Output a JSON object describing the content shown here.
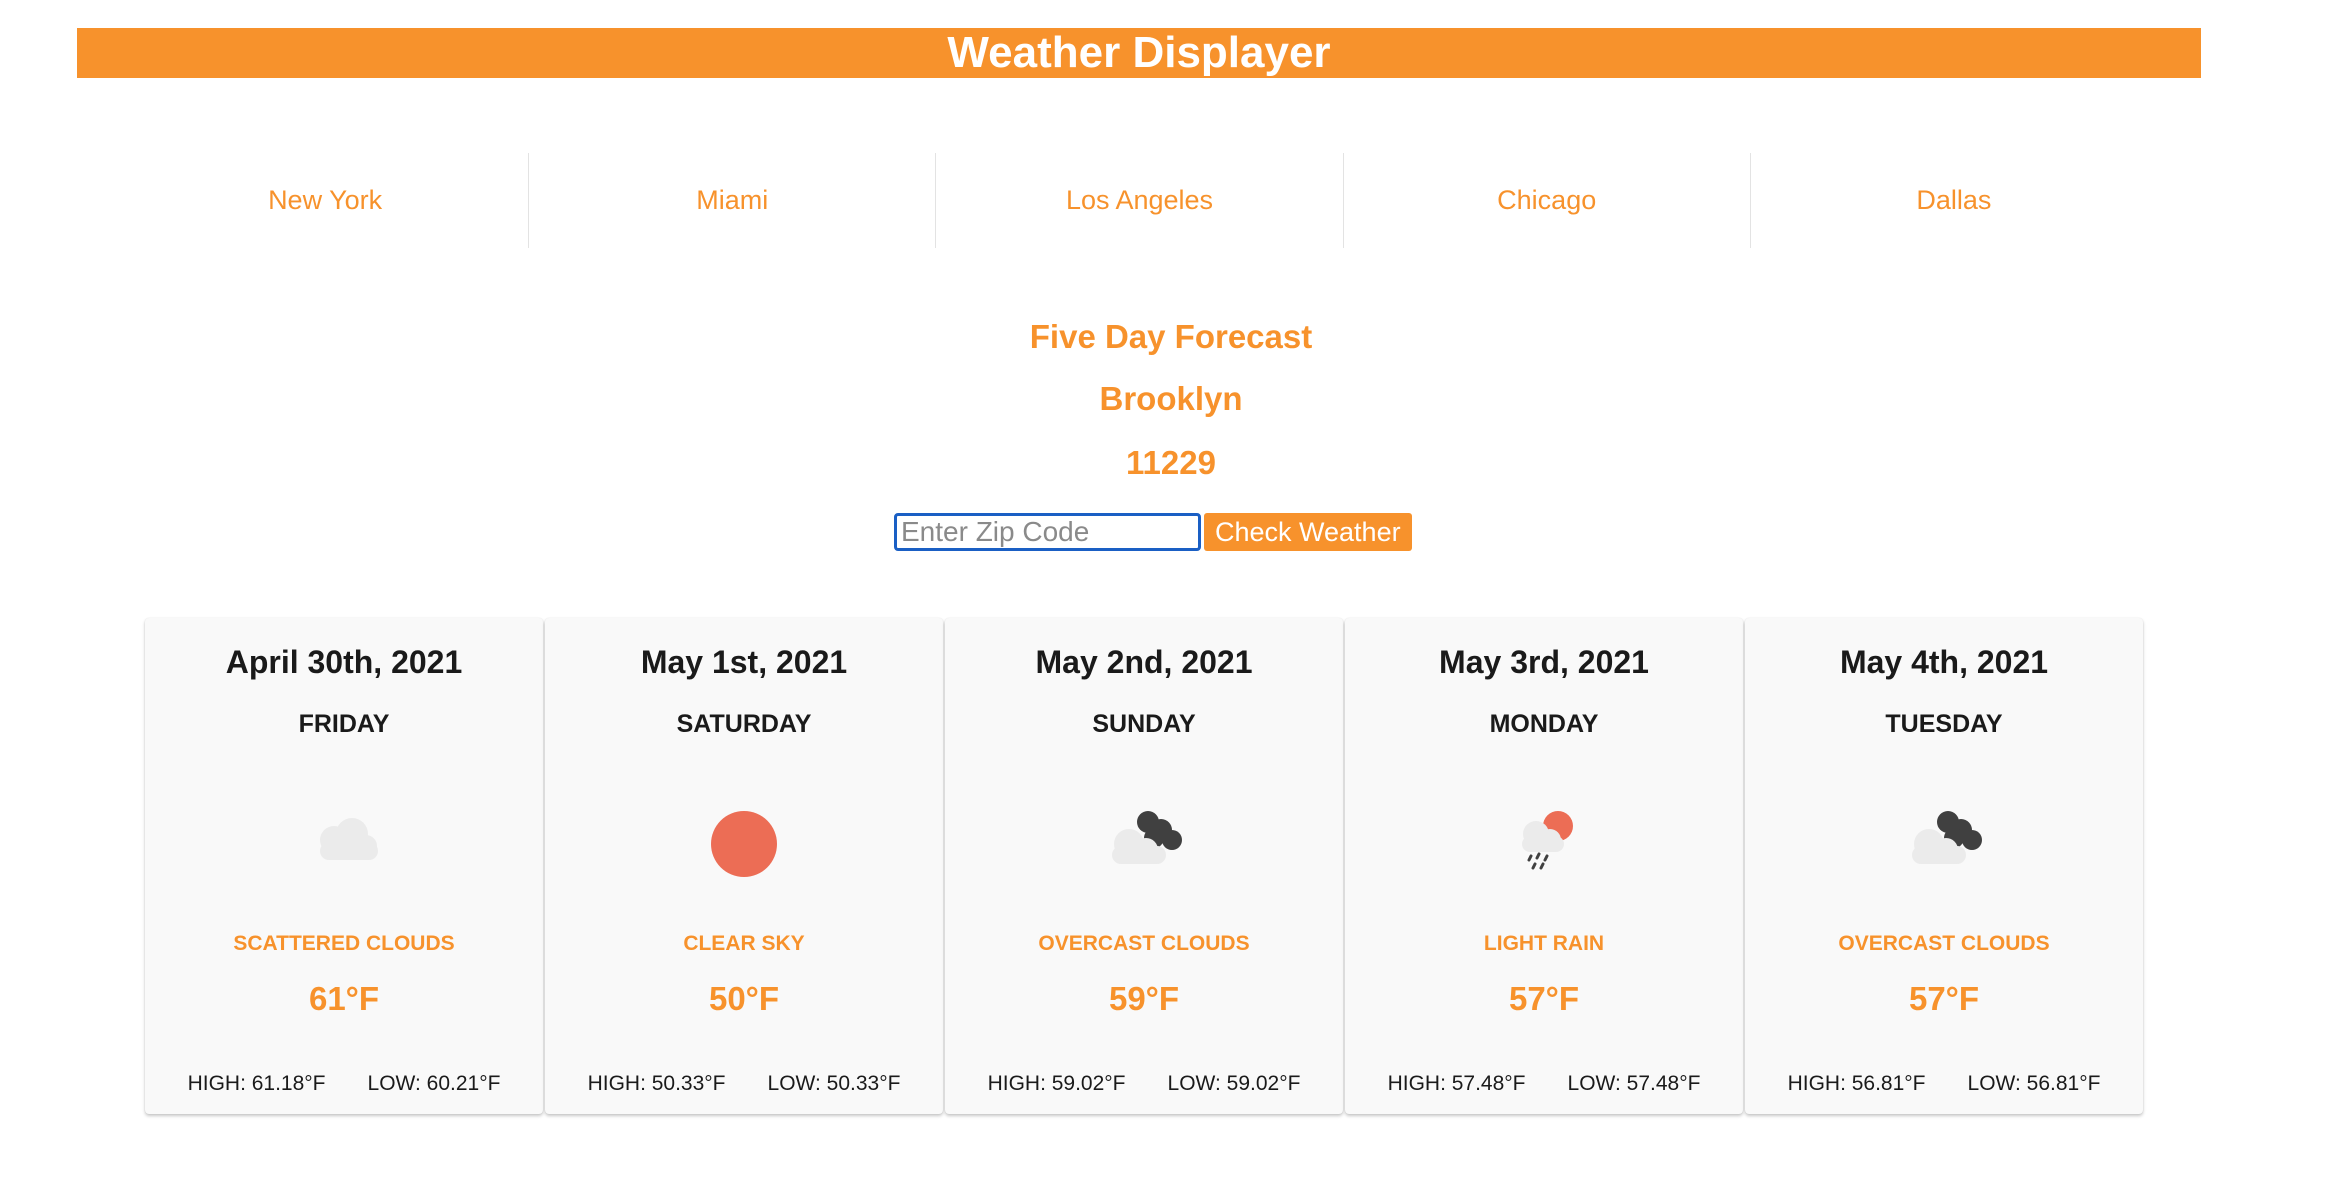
{
  "app": {
    "title": "Weather Displayer"
  },
  "cities": [
    "New York",
    "Miami",
    "Los Angeles",
    "Chicago",
    "Dallas"
  ],
  "forecast": {
    "heading": "Five Day Forecast",
    "location": "Brooklyn",
    "zip": "11229"
  },
  "search": {
    "placeholder": "Enter Zip Code",
    "button_label": "Check Weather"
  },
  "days": [
    {
      "date": "April 30th, 2021",
      "weekday": "FRIDAY",
      "icon": "scattered-clouds-icon",
      "description": "SCATTERED CLOUDS",
      "temp": "61°F",
      "high": "HIGH: 61.18°F",
      "low": "LOW: 60.21°F"
    },
    {
      "date": "May 1st, 2021",
      "weekday": "SATURDAY",
      "icon": "clear-sky-icon",
      "description": "CLEAR SKY",
      "temp": "50°F",
      "high": "HIGH: 50.33°F",
      "low": "LOW: 50.33°F"
    },
    {
      "date": "May 2nd, 2021",
      "weekday": "SUNDAY",
      "icon": "overcast-clouds-icon",
      "description": "OVERCAST CLOUDS",
      "temp": "59°F",
      "high": "HIGH: 59.02°F",
      "low": "LOW: 59.02°F"
    },
    {
      "date": "May 3rd, 2021",
      "weekday": "MONDAY",
      "icon": "light-rain-icon",
      "description": "LIGHT RAIN",
      "temp": "57°F",
      "high": "HIGH: 57.48°F",
      "low": "LOW: 57.48°F"
    },
    {
      "date": "May 4th, 2021",
      "weekday": "TUESDAY",
      "icon": "overcast-clouds-icon",
      "description": "OVERCAST CLOUDS",
      "temp": "57°F",
      "high": "HIGH: 56.81°F",
      "low": "LOW: 56.81°F"
    }
  ],
  "colors": {
    "accent": "#f7922c",
    "sun": "#ec6d55",
    "cloud_light": "#ebebeb",
    "cloud_dark": "#404040",
    "input_border": "#1a5fc4"
  }
}
